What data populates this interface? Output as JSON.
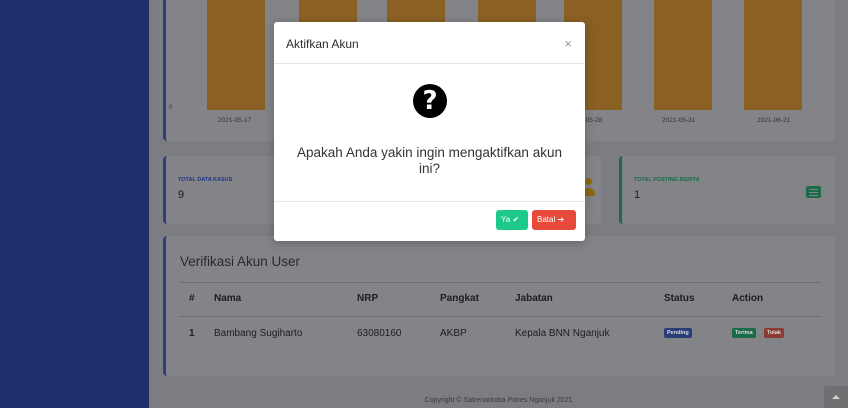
{
  "chart": {
    "zero_label": "0",
    "x_labels": [
      "2021-05-17",
      "2021-05-28",
      "2021-05-31",
      "2021-06-21"
    ]
  },
  "chart_data": {
    "type": "bar",
    "categories": [
      "2021-05-17",
      "",
      "",
      "",
      "2021-05-28",
      "2021-05-31",
      "2021-06-21"
    ],
    "bar_color": "#f6b23e",
    "ylim": [
      0,
      null
    ],
    "y_tick_labels": [
      "0"
    ]
  },
  "stats": [
    {
      "label": "TOTAL DATA KASUS",
      "value": "9"
    },
    {
      "label": "TOTAL POSTING BERITA",
      "value": "1"
    }
  ],
  "table": {
    "title": "Verifikasi Akun User",
    "headers": [
      "#",
      "Nama",
      "NRP",
      "Pangkat",
      "Jabatan",
      "Status",
      "Action"
    ],
    "rows": [
      {
        "no": "1",
        "nama": "Bambang Sugiharto",
        "nrp": "63080160",
        "pangkat": "AKBP",
        "jabatan": "Kepala BNN Nganjuk",
        "status": "Pending",
        "accept": "Terima",
        "reject": "Tolak"
      }
    ]
  },
  "footer": {
    "copyright": "Copyright © Satrenarkoba Polres Nganjuk 2021"
  },
  "modal": {
    "title": "Aktifkan Akun",
    "close": "×",
    "icon": "question-circle-icon",
    "message": "Apakah Anda yakin ingin mengaktifkan akun ini?",
    "yes_label": "Ya",
    "cancel_label": "Batal"
  },
  "colors": {
    "sidebar": "#1f2f6b",
    "overlay": "#7b7d84",
    "bar": "#f6b23e",
    "success": "#1cc88a",
    "danger": "#e74a3b",
    "primary": "#4e73df"
  }
}
